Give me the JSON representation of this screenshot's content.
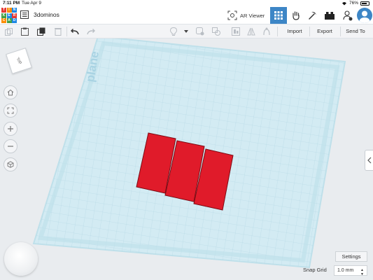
{
  "status_bar": {
    "time": "7:11 PM",
    "date": "Tue Apr 9",
    "battery": "76%"
  },
  "app": {
    "logo_letters": [
      "TIN",
      "KER",
      "CAD"
    ],
    "document_title": "3dominos",
    "ar_viewer_label": "AR Viewer"
  },
  "toolbar": {
    "import_label": "Import",
    "export_label": "Export",
    "send_to_label": "Send To"
  },
  "workplane": {
    "label": "plane",
    "color": "#cfe8f1",
    "grid_color": "#a8d0df"
  },
  "view_cube": {
    "face_label": "Top"
  },
  "shapes": {
    "color": "#e01b2a",
    "count": 3
  },
  "settings": {
    "settings_label": "Settings",
    "snap_grid_label": "Snap Grid",
    "snap_grid_value": "1.0 mm"
  },
  "colors": {
    "accent": "#3d86c6"
  }
}
